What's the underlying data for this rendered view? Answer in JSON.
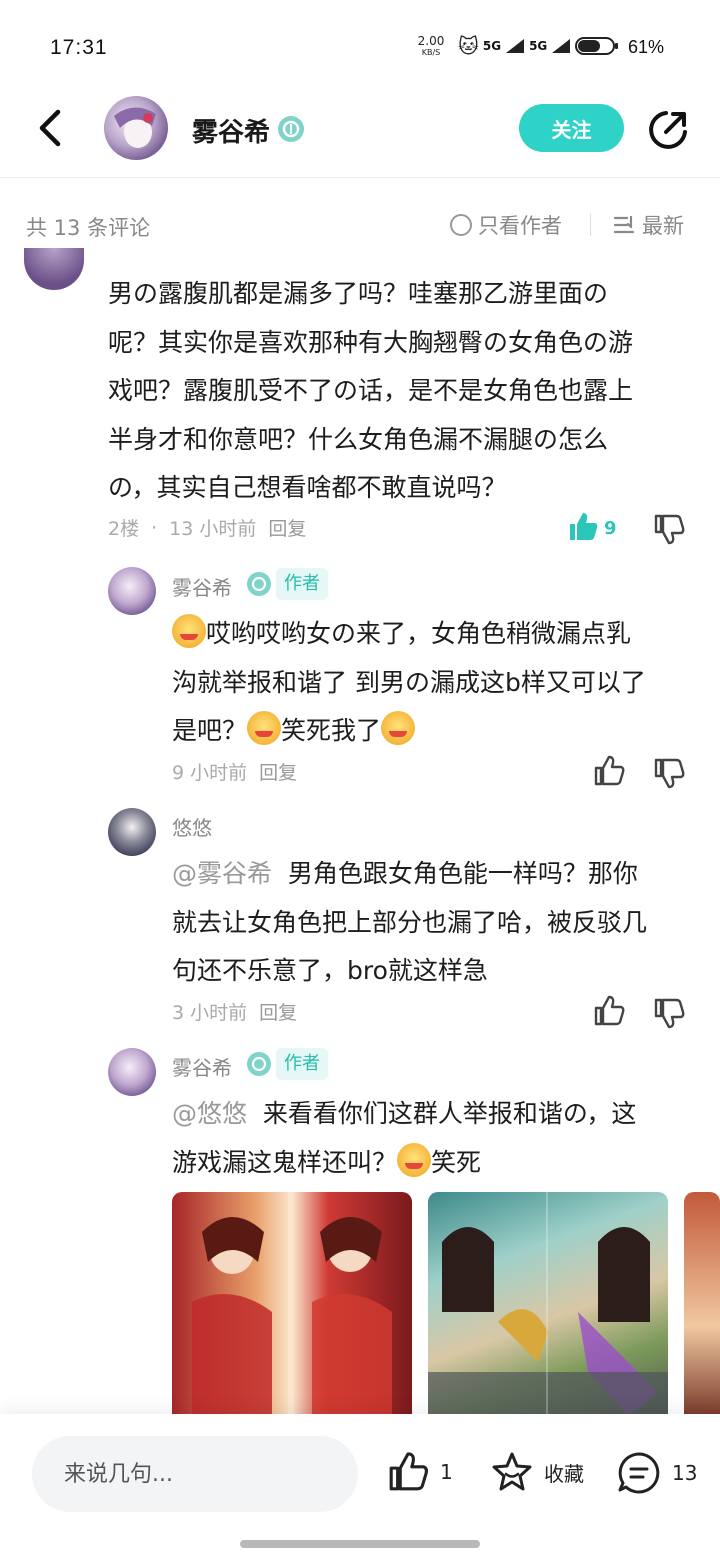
{
  "status_bar": {
    "time": "17:31",
    "net_speed_value": "2.00",
    "net_speed_unit": "KB/S",
    "signal_1": "5G",
    "signal_2": "5G",
    "battery": "61%"
  },
  "header": {
    "author_name": "雾谷希",
    "follow_label": "关注"
  },
  "list_header": {
    "count_text": "共 13 条评论",
    "author_only_label": "只看作者",
    "sort_label": "最新"
  },
  "main_comment": {
    "lines": [
      "男の露腹肌都是漏多了吗？哇塞那乙游里面の",
      "呢？其实你是喜欢那种有大胸翘臀の女角色の游",
      "戏吧？露腹肌受不了の话，是不是女角色也露上",
      "半身才和你意吧？什么女角色漏不漏腿の怎么",
      "の，其实自己想看啥都不敢直说吗？"
    ],
    "floor": "2楼",
    "time": "13 小时前",
    "reply_label": "回复",
    "like_count": "9"
  },
  "replies": [
    {
      "name": "雾谷希",
      "tag": "作者",
      "line1_text": "哎哟哎哟女の来了，女角色稍微漏点乳",
      "line2": "沟就举报和谐了 到男の漏成这b样又可以了",
      "line3_a": "是吧？",
      "line3_b": "笑死我了",
      "time": "9 小时前",
      "reply_label": "回复"
    },
    {
      "name": "悠悠",
      "mention": "@雾谷希",
      "line1_text": "男角色跟女角色能一样吗？那你",
      "line2": "就去让女角色把上部分也漏了哈，被反驳几",
      "line3": "句还不乐意了，bro就这样急",
      "time": "3 小时前",
      "reply_label": "回复"
    },
    {
      "name": "雾谷希",
      "tag": "作者",
      "mention": "@悠悠",
      "line1_text": "来看看你们这群人举报和谐の，这",
      "line2_text": "游戏漏这鬼样还叫？",
      "line2_tail": "笑死"
    }
  ],
  "bottom_bar": {
    "input_placeholder": "来说几句...",
    "like_count": "1",
    "favorite_label": "收藏",
    "comment_count": "13"
  },
  "colors": {
    "accent": "#2fd2c6",
    "author_tag_bg": "#e6f8f6",
    "author_tag_text": "#26bcae",
    "muted_text": "#aaaaaa"
  }
}
